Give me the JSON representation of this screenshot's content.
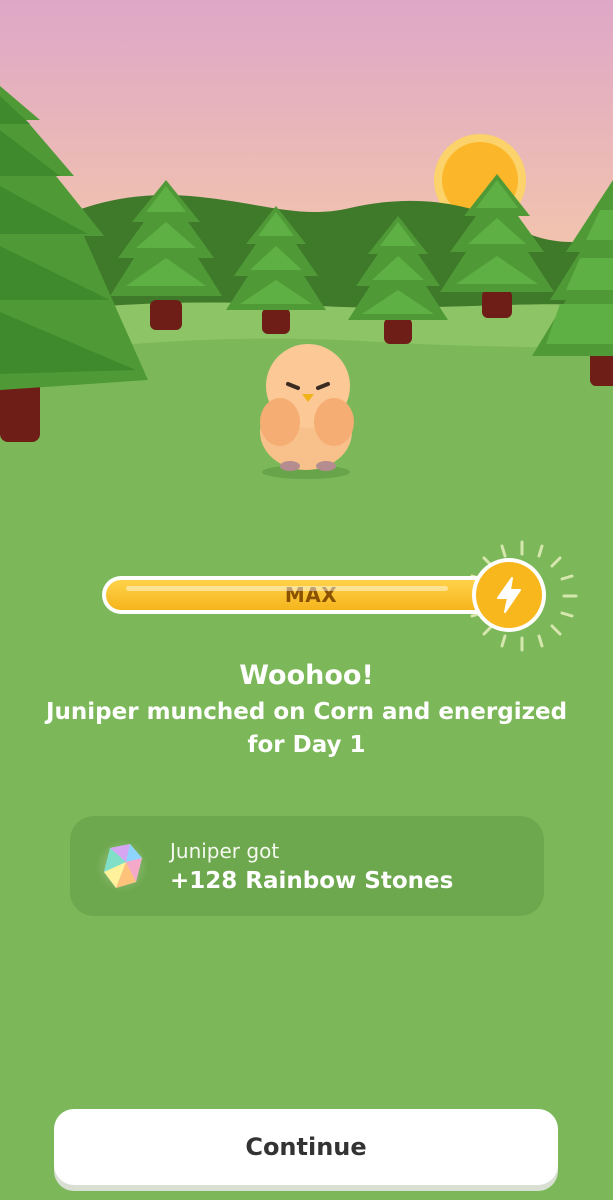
{
  "colors": {
    "sky_top": "#e0a6c5",
    "sky_bottom": "#f4c9a8",
    "sun": "#fbb62a",
    "hill_dark": "#3f7a2b",
    "meadow_light": "#8dc566",
    "ground": "#7cb85a",
    "tree_green": "#4f9a36",
    "tree_trunk": "#6e1e16",
    "energy_fill": "#f5b51c",
    "card_bg": "#6ea84e",
    "button_bg": "#ffffff"
  },
  "pet": {
    "name": "Juniper",
    "icon": "chick-pet-icon"
  },
  "energy": {
    "label": "MAX",
    "level": 1.0,
    "icon": "lightning-bolt-icon"
  },
  "message": {
    "headline": "Woohoo!",
    "subline": "Juniper munched on Corn and energized for Day 1"
  },
  "reward": {
    "icon": "rainbow-stone-icon",
    "caption": "Juniper got",
    "amount": "+128 Rainbow Stones"
  },
  "continue_button": {
    "label": "Continue"
  }
}
